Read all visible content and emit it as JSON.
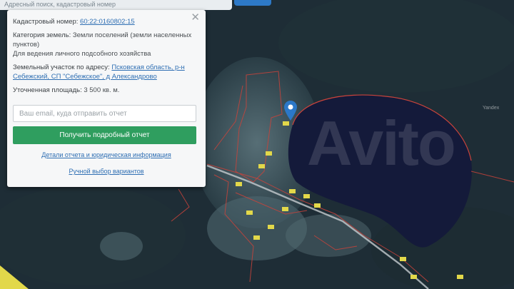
{
  "search": {
    "text": "Адресный поиск, кадастровый номер"
  },
  "panel": {
    "cadastral_label": "Кадастровый номер:",
    "cadastral_value": "60:22:0160802:15",
    "category_label": "Категория земель:",
    "category_value": "Земли поселений (земли населенных пунктов)",
    "usage": "Для ведения личного подсобного хозяйства",
    "address_label": "Земельный участок по адресу:",
    "address_value": "Псковская область, р-н Себежский, СП \"Себежское\", д Александрово",
    "area_label": "Уточненная площадь:",
    "area_value": "3 500 кв. м.",
    "email_placeholder": "Ваш email, куда отправить отчет",
    "submit_label": "Получить подробный отчет",
    "details_link": "Детали отчета и юридическая информация",
    "manual_link": "Ручной выбор вариантов"
  },
  "map": {
    "watermark": "Avito",
    "attribution": "Yandex",
    "colors": {
      "forest": "#22323b",
      "lake": "#141a3a",
      "boundary": "#c9433b",
      "marker": "#2b78c8",
      "plot": "#e2d84a"
    }
  }
}
